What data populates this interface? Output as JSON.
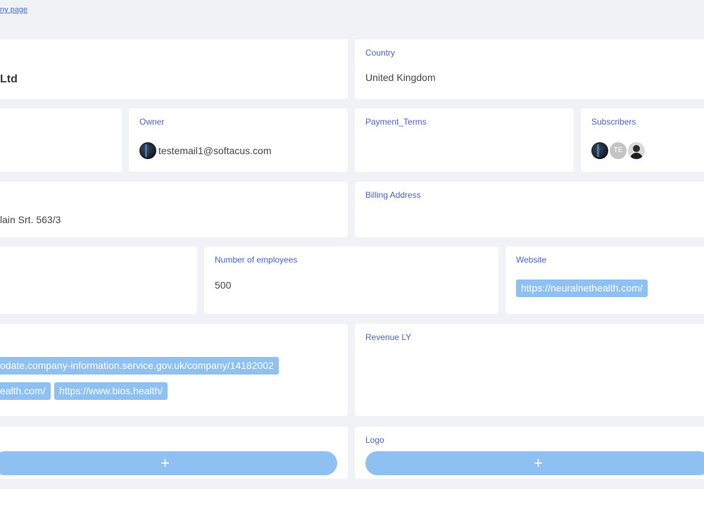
{
  "top_link": "ny page",
  "company": {
    "name_partial": "Ltd"
  },
  "country": {
    "label": "Country",
    "value": "United Kingdom"
  },
  "owner": {
    "label": "Owner",
    "email": "testemail1@softacus.com"
  },
  "payment_terms": {
    "label": "Payment_Terms"
  },
  "subscribers": {
    "label": "Subscribers",
    "avatars": [
      "photo-dark",
      "TE",
      "photo-person"
    ]
  },
  "address": {
    "value_partial": "lain Srt. 563/3"
  },
  "billing_address": {
    "label": "Billing Address"
  },
  "employees": {
    "label": "Number of employees",
    "value": "500"
  },
  "website": {
    "label": "Website",
    "url": "https://neuralnethealth.com/"
  },
  "links": {
    "tags": [
      "odate.company-information.service.gov.uk/company/14182002",
      "ealth.com/",
      "https://www.bios.health/"
    ]
  },
  "revenue_ly": {
    "label": "Revenue LY"
  },
  "logo": {
    "label": "Logo"
  },
  "add_icon": "+",
  "colors": {
    "background": "#f1f2f5",
    "label": "#4a64c9",
    "tag": "#8ec0f2",
    "link": "#3b6fd8"
  }
}
